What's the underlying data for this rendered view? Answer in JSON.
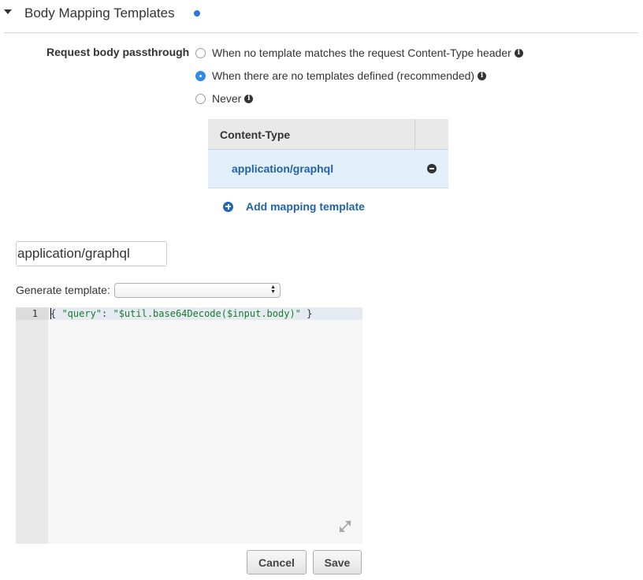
{
  "section": {
    "title": "Body Mapping Templates",
    "accent_color": "#2e78d2"
  },
  "passthrough": {
    "label": "Request body passthrough",
    "options": [
      {
        "label": "When no template matches the request Content-Type header",
        "selected": false,
        "info_icon": true
      },
      {
        "label": "When there are no templates defined (recommended)",
        "selected": true,
        "info_icon": true
      },
      {
        "label": "Never",
        "selected": false,
        "info_icon": true
      }
    ]
  },
  "content_type_table": {
    "header": "Content-Type",
    "rows": [
      {
        "label": "application/graphql",
        "selected": true
      }
    ]
  },
  "add_mapping": {
    "label": "Add mapping template",
    "icon": "plus-circle-icon"
  },
  "content_type_input": {
    "value": "application/graphql"
  },
  "generate_template": {
    "label": "Generate template:",
    "selected": ""
  },
  "editor": {
    "lines": [
      {
        "number": "1",
        "text": "{ \"query\": \"$util.base64Decode($input.body)\" }"
      }
    ]
  },
  "buttons": {
    "cancel": "Cancel",
    "save": "Save"
  },
  "colors": {
    "link": "#1f63a8",
    "radio_selected": "#2e8be6",
    "row_selected_bg": "#e3effb"
  }
}
